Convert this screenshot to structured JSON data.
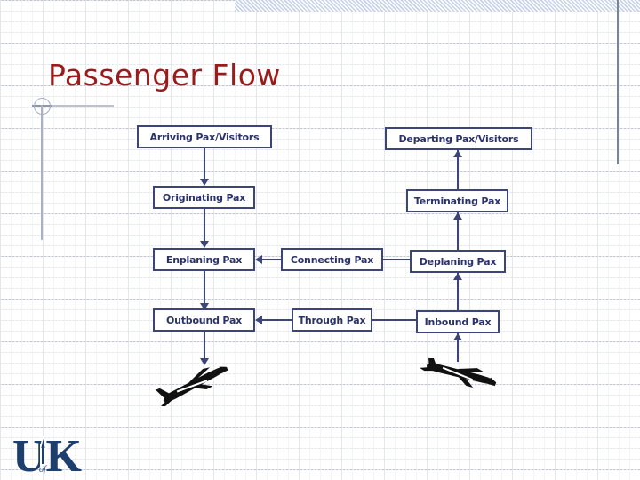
{
  "slide": {
    "title": "Passenger Flow",
    "title_color": "#9b1b1b",
    "node_color": "#2b3268",
    "node_border_color": "#3d4477",
    "background": "#ffffff",
    "band_color": "#c3d0e6",
    "rule_color": "#7a8597"
  },
  "logo": {
    "main_text": "UK",
    "sub_text": "of",
    "color": "#1d3f6e"
  },
  "diagram": {
    "nodes": [
      {
        "id": "arriving",
        "label": "Arriving Pax/Visitors"
      },
      {
        "id": "departing",
        "label": "Departing Pax/Visitors"
      },
      {
        "id": "originating",
        "label": "Originating Pax"
      },
      {
        "id": "terminating",
        "label": "Terminating Pax"
      },
      {
        "id": "enplaning",
        "label": "Enplaning Pax"
      },
      {
        "id": "connecting",
        "label": "Connecting Pax"
      },
      {
        "id": "deplaning",
        "label": "Deplaning Pax"
      },
      {
        "id": "outbound",
        "label": "Outbound Pax"
      },
      {
        "id": "through",
        "label": "Through Pax"
      },
      {
        "id": "inbound",
        "label": "Inbound Pax"
      }
    ],
    "edges": [
      {
        "from": "arriving",
        "to": "originating",
        "direction": "down"
      },
      {
        "from": "originating",
        "to": "enplaning",
        "direction": "down"
      },
      {
        "from": "enplaning",
        "to": "outbound",
        "direction": "down"
      },
      {
        "from": "outbound",
        "to": "plane-departing",
        "direction": "down"
      },
      {
        "from": "plane-arriving",
        "to": "inbound",
        "direction": "up"
      },
      {
        "from": "inbound",
        "to": "deplaning",
        "direction": "up"
      },
      {
        "from": "deplaning",
        "to": "terminating",
        "direction": "up"
      },
      {
        "from": "terminating",
        "to": "departing",
        "direction": "up"
      },
      {
        "from": "connecting",
        "to": "enplaning",
        "direction": "left"
      },
      {
        "from": "deplaning",
        "to": "connecting",
        "direction": "none"
      },
      {
        "from": "through",
        "to": "outbound",
        "direction": "left"
      },
      {
        "from": "inbound",
        "to": "through",
        "direction": "none"
      }
    ],
    "icons": [
      {
        "id": "plane-departing",
        "name": "airplane-departing-icon"
      },
      {
        "id": "plane-arriving",
        "name": "airplane-arriving-icon"
      }
    ]
  }
}
